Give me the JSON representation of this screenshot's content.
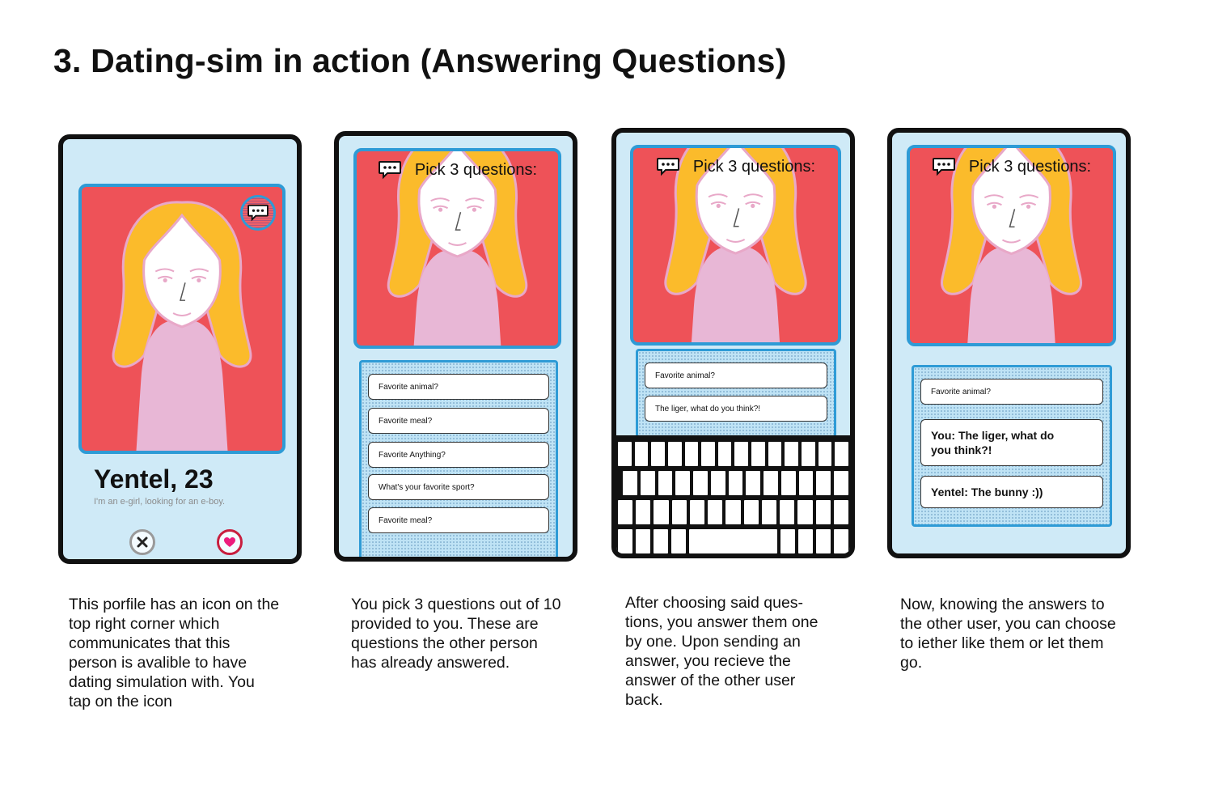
{
  "page": {
    "title": "3. Dating-sim in action (Answering Questions)"
  },
  "colors": {
    "phone_bg": "#cfeaf7",
    "photo_bg": "#ee5258",
    "hair": "#fbbb2b",
    "skin_outline": "#e8a8c8",
    "shirt": "#e8b7d6",
    "accent_blue": "#2e9bd6",
    "like_red": "#c81e3e",
    "like_heart": "#ec1a7c"
  },
  "panel1": {
    "badge_icon": "chat-bubble-icon",
    "profile_name": "Yentel, 23",
    "profile_bio": "I'm an e-girl, looking for an e-boy.",
    "reject_icon": "close-x-icon",
    "like_icon": "heart-icon",
    "caption": "This porfile has an icon on the top right corner which communicates that this person is avalible to have dating simulation with. You tap on the icon"
  },
  "panel2": {
    "header": "Pick 3 questions:",
    "questions": [
      "Favorite animal?",
      "Favorite meal?",
      "Favorite Anything?",
      "What's your favorite sport?",
      "Favorite meal?"
    ],
    "caption": "You pick 3 questions out of 10 provided to you. These are questions the other person has already answered."
  },
  "panel3": {
    "header": "Pick 3 questions:",
    "question": "Favorite animal?",
    "draft_answer": "The liger, what do you think?!",
    "caption": "After choosing said ques- tions, you answer them one by one. Upon sending an answer, you recieve the answer of the other user back."
  },
  "panel4": {
    "header": "Pick 3 questions:",
    "question": "Favorite animal?",
    "your_answer": "You: The liger, what do you think?!",
    "their_answer": "Yentel: The bunny :))",
    "caption": "Now, knowing the answers to the other user, you can choose to iether like them or let them go."
  }
}
